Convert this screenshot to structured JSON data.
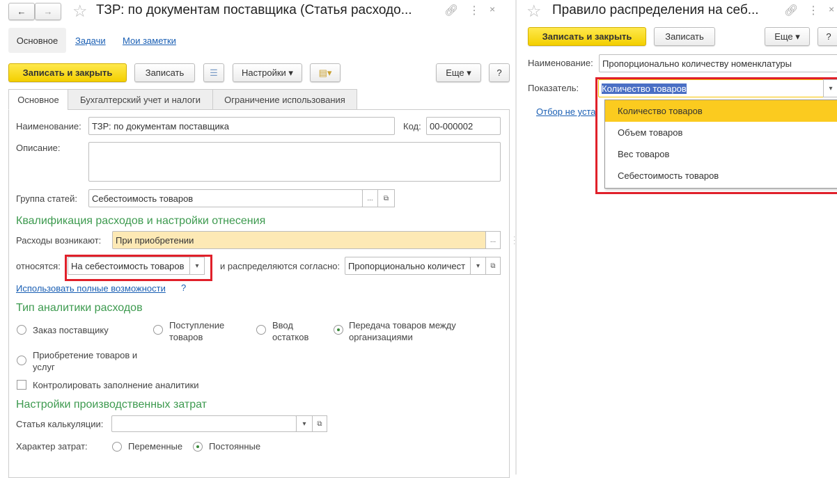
{
  "left": {
    "title": "ТЗР: по документам поставщика (Статья расходо...",
    "nav_tabs": [
      "Основное",
      "Задачи",
      "Мои заметки"
    ],
    "toolbar": {
      "save_close": "Записать и закрыть",
      "save": "Записать",
      "settings": "Настройки ▾",
      "more": "Еще ▾",
      "help": "?"
    },
    "tabs": [
      "Основное",
      "Бухгалтерский учет и налоги",
      "Ограничение использования"
    ],
    "name_label": "Наименование:",
    "name_value": "ТЗР: по документам поставщика",
    "code_label": "Код:",
    "code_value": "00-000002",
    "desc_label": "Описание:",
    "group_label": "Группа статей:",
    "group_value": "Себестоимость товаров",
    "section1": "Квалификация расходов и настройки отнесения",
    "arise_label": "Расходы возникают:",
    "arise_value": "При приобретении",
    "relate_label": "относятся:",
    "relate_value": "На себестоимость товаров",
    "distrib_label": "и распределяются согласно:",
    "distrib_value": "Пропорционально количест",
    "full_link": "Использовать полные возможности",
    "help_q": "?",
    "section2": "Тип аналитики расходов",
    "radios": [
      "Заказ поставщику",
      "Поступление\nтоваров",
      "Ввод\nостатков",
      "Передача товаров между\nорганизациями",
      "Приобретение товаров и\nуслуг"
    ],
    "checkbox": "Контролировать заполнение аналитики",
    "section3": "Настройки производственных затрат",
    "calc_label": "Статья калькуляции:",
    "cost_label": "Характер затрат:",
    "cost_opts": [
      "Переменные",
      "Постоянные"
    ]
  },
  "right": {
    "title": "Правило распределения на себ...",
    "toolbar": {
      "save_close": "Записать и закрыть",
      "save": "Записать",
      "more": "Еще ▾",
      "help": "?"
    },
    "name_label": "Наименование:",
    "name_value": "Пропорционально количеству номенклатуры",
    "ind_label": "Показатель:",
    "ind_value": "Количество товаров",
    "filter_link": "Отбор не уста",
    "options": [
      "Количество товаров",
      "Объем товаров",
      "Вес товаров",
      "Себестоимость товаров"
    ]
  }
}
